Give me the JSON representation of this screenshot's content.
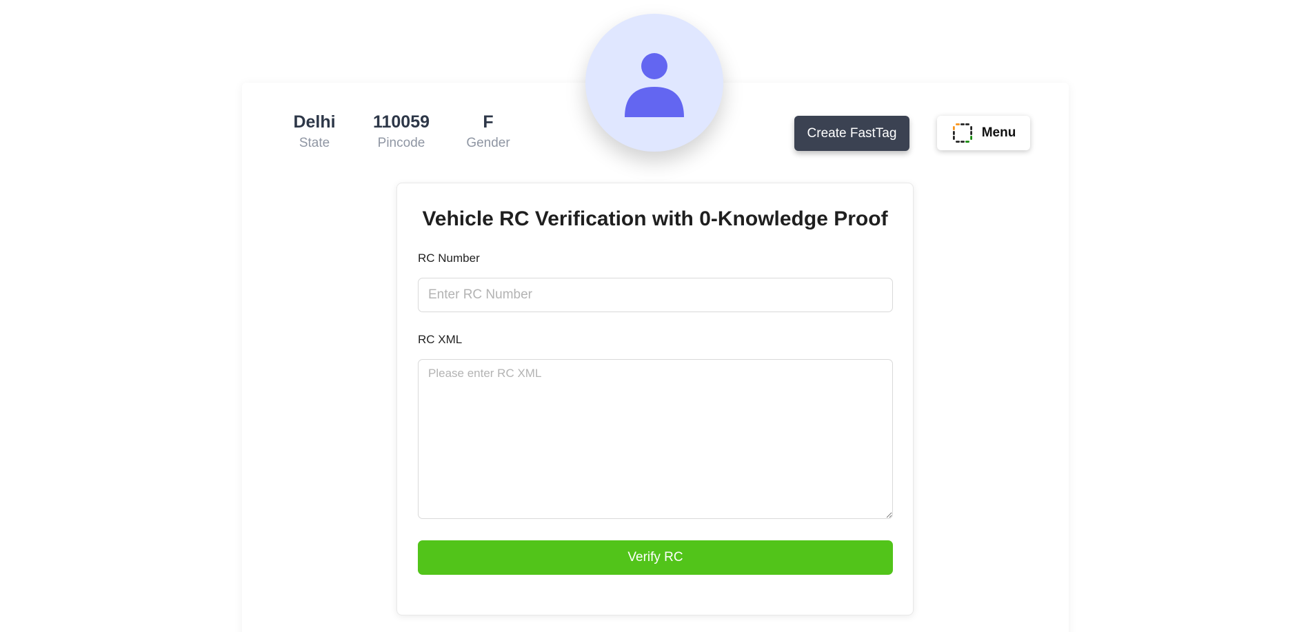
{
  "profile": {
    "stats": [
      {
        "value": "Delhi",
        "label": "State"
      },
      {
        "value": "110059",
        "label": "Pincode"
      },
      {
        "value": "F",
        "label": "Gender"
      }
    ],
    "avatar_icon": "user-icon",
    "create_fasttag_label": "Create FastTag",
    "menu_label": "Menu",
    "menu_icon": "digilocker-logo-icon"
  },
  "form": {
    "title": "Vehicle RC Verification with 0-Knowledge Proof",
    "rc_number": {
      "label": "RC Number",
      "placeholder": "Enter RC Number",
      "value": ""
    },
    "rc_xml": {
      "label": "RC XML",
      "placeholder": "Please enter RC XML",
      "value": ""
    },
    "verify_label": "Verify RC"
  },
  "colors": {
    "avatar_bg": "#e0e7ff",
    "avatar_fg": "#6366f1",
    "fasttag_button": "#3b4252",
    "verify_button": "#52c41a",
    "stat_value": "#2d3748",
    "stat_label": "#8f96a3"
  }
}
